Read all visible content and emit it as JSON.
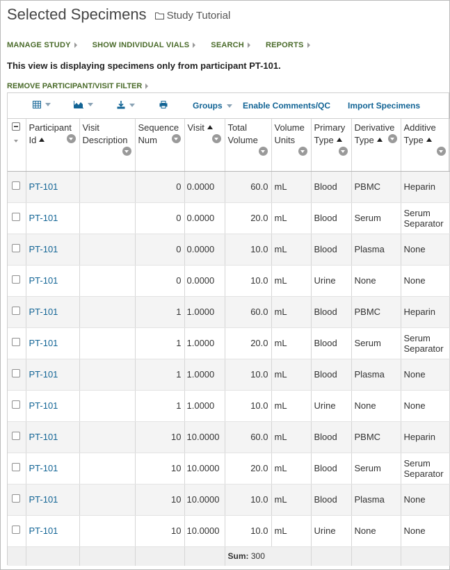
{
  "page": {
    "title": "Selected Specimens",
    "folder": "Study Tutorial"
  },
  "menu": [
    {
      "label": "MANAGE STUDY"
    },
    {
      "label": "SHOW INDIVIDUAL VIALS"
    },
    {
      "label": "SEARCH"
    },
    {
      "label": "REPORTS"
    }
  ],
  "info_text": "This view is displaying specimens only from participant PT-101.",
  "filter_link": "REMOVE PARTICIPANT/VISIT FILTER",
  "toolbar": {
    "groups": "Groups",
    "comments": "Enable Comments/QC",
    "import": "Import Specimens"
  },
  "columns": [
    {
      "label": "Participant Id"
    },
    {
      "label": "Visit Description"
    },
    {
      "label": "Sequence Num"
    },
    {
      "label": "Visit"
    },
    {
      "label": "Total Volume"
    },
    {
      "label": "Volume Units"
    },
    {
      "label": "Primary Type"
    },
    {
      "label": "Derivative Type"
    },
    {
      "label": "Additive Type"
    }
  ],
  "rows": [
    {
      "participant": "PT-101",
      "visit_desc": "",
      "seq": "0",
      "visit": "0.0000",
      "volume": "60.0",
      "units": "mL",
      "primary": "Blood",
      "derivative": "PBMC",
      "additive": "Heparin"
    },
    {
      "participant": "PT-101",
      "visit_desc": "",
      "seq": "0",
      "visit": "0.0000",
      "volume": "20.0",
      "units": "mL",
      "primary": "Blood",
      "derivative": "Serum",
      "additive": "Serum Separator"
    },
    {
      "participant": "PT-101",
      "visit_desc": "",
      "seq": "0",
      "visit": "0.0000",
      "volume": "10.0",
      "units": "mL",
      "primary": "Blood",
      "derivative": "Plasma",
      "additive": "None"
    },
    {
      "participant": "PT-101",
      "visit_desc": "",
      "seq": "0",
      "visit": "0.0000",
      "volume": "10.0",
      "units": "mL",
      "primary": "Urine",
      "derivative": "None",
      "additive": "None"
    },
    {
      "participant": "PT-101",
      "visit_desc": "",
      "seq": "1",
      "visit": "1.0000",
      "volume": "60.0",
      "units": "mL",
      "primary": "Blood",
      "derivative": "PBMC",
      "additive": "Heparin"
    },
    {
      "participant": "PT-101",
      "visit_desc": "",
      "seq": "1",
      "visit": "1.0000",
      "volume": "20.0",
      "units": "mL",
      "primary": "Blood",
      "derivative": "Serum",
      "additive": "Serum Separator"
    },
    {
      "participant": "PT-101",
      "visit_desc": "",
      "seq": "1",
      "visit": "1.0000",
      "volume": "10.0",
      "units": "mL",
      "primary": "Blood",
      "derivative": "Plasma",
      "additive": "None"
    },
    {
      "participant": "PT-101",
      "visit_desc": "",
      "seq": "1",
      "visit": "1.0000",
      "volume": "10.0",
      "units": "mL",
      "primary": "Urine",
      "derivative": "None",
      "additive": "None"
    },
    {
      "participant": "PT-101",
      "visit_desc": "",
      "seq": "10",
      "visit": "10.0000",
      "volume": "60.0",
      "units": "mL",
      "primary": "Blood",
      "derivative": "PBMC",
      "additive": "Heparin"
    },
    {
      "participant": "PT-101",
      "visit_desc": "",
      "seq": "10",
      "visit": "10.0000",
      "volume": "20.0",
      "units": "mL",
      "primary": "Blood",
      "derivative": "Serum",
      "additive": "Serum Separator"
    },
    {
      "participant": "PT-101",
      "visit_desc": "",
      "seq": "10",
      "visit": "10.0000",
      "volume": "10.0",
      "units": "mL",
      "primary": "Blood",
      "derivative": "Plasma",
      "additive": "None"
    },
    {
      "participant": "PT-101",
      "visit_desc": "",
      "seq": "10",
      "visit": "10.0000",
      "volume": "10.0",
      "units": "mL",
      "primary": "Urine",
      "derivative": "None",
      "additive": "None"
    }
  ],
  "footer": {
    "sum_label": "Sum:",
    "sum_value": "300"
  },
  "colors": {
    "link": "#126495",
    "menu": "#4a6b2a"
  }
}
